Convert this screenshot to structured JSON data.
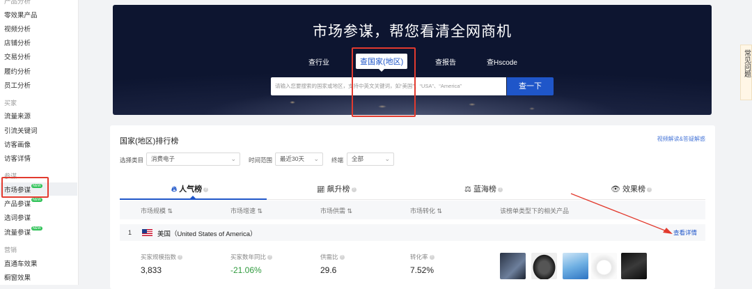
{
  "sidebar": {
    "top_cut": "产品分析",
    "items_a": [
      "零效果产品",
      "视频分析",
      "店铺分析",
      "交易分析",
      "履约分析",
      "员工分析"
    ],
    "group_buyer": "买家",
    "items_b": [
      "流量来源",
      "引流关键词",
      "访客画像",
      "访客详情"
    ],
    "group_advisor": "参谋",
    "items_c": [
      {
        "label": "市场参谋",
        "badge": "NEW"
      },
      {
        "label": "产品参谋",
        "badge": "NEW"
      },
      {
        "label": "选词参谋",
        "badge": ""
      },
      {
        "label": "流量参谋",
        "badge": "NEW"
      }
    ],
    "group_marketing": "营销",
    "items_d": [
      "直通车效果",
      "橱窗效果"
    ]
  },
  "hero": {
    "title": "市场参谋，帮您看清全网商机",
    "tabs": [
      "查行业",
      "查国家(地区)",
      "查报告",
      "查Hscode"
    ],
    "active_tab": 1,
    "search_placeholder": "请输入您要搜索的国家或地区，支持中英文关键词，如“美国”、“USA”、“America”",
    "search_button": "查一下"
  },
  "ranking": {
    "title": "国家(地区)排行榜",
    "help_link": "视频解读&答疑解惑",
    "filters": {
      "category_label": "选择类目",
      "category_value": "消费电子",
      "time_label": "时间范围",
      "time_value": "最近30天",
      "device_label": "终端",
      "device_value": "全部"
    },
    "tabs": [
      {
        "label": "人气榜",
        "icon": "flame-icon"
      },
      {
        "label": "飙升榜",
        "icon": "rising-chart-icon"
      },
      {
        "label": "蓝海榜",
        "icon": "balance-scale-icon"
      },
      {
        "label": "效果榜",
        "icon": "eye-icon"
      }
    ],
    "active_tab": 0,
    "columns": [
      "市场规模",
      "市场增速",
      "市场供需",
      "市场转化",
      "该榜单类型下的相关产品"
    ],
    "rows": [
      {
        "rank": "1",
        "name": "美国（United States of America）",
        "detail_link": "查看详情",
        "metrics": [
          {
            "label": "买家规模指数",
            "value": "3,833"
          },
          {
            "label": "买家数年同比",
            "value": "-21.06%"
          },
          {
            "label": "供需比",
            "value": "29.6"
          },
          {
            "label": "转化率",
            "value": "7.52%"
          }
        ]
      }
    ]
  },
  "help_widget": {
    "text": "常见问题"
  },
  "colors": {
    "accent": "#1f56c9",
    "annotation_red": "#e23a2e",
    "positive_green": "#2f9a3d"
  }
}
